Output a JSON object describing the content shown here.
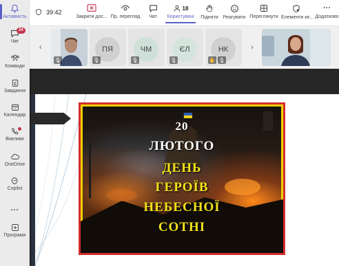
{
  "rail": {
    "items": [
      {
        "label": "Активність",
        "icon": "bell-icon"
      },
      {
        "label": "Чат",
        "icon": "chat-icon",
        "badge": "24"
      },
      {
        "label": "Команди",
        "icon": "teams-icon"
      },
      {
        "label": "Завдання",
        "icon": "tasks-icon"
      },
      {
        "label": "Календар",
        "icon": "calendar-icon"
      },
      {
        "label": "Виклики",
        "icon": "phone-icon"
      },
      {
        "label": "OneDrive",
        "icon": "cloud-icon"
      },
      {
        "label": "Copilot",
        "icon": "copilot-icon"
      },
      {
        "label": "...",
        "icon": "more-icon"
      },
      {
        "label": "Програми",
        "icon": "apps-icon"
      }
    ]
  },
  "topbar": {
    "timer": "39:42",
    "buttons": {
      "close_share": "Закрити дос...",
      "preview": "Пр. перегляд",
      "chat": "Чат",
      "people": "Користувачі",
      "people_count": "18",
      "raise": "Підняти",
      "react": "Реагувати",
      "view": "Переглянути",
      "captions": "Елементи ке...",
      "more": "Додатково"
    }
  },
  "participants": [
    {
      "type": "video",
      "name": ""
    },
    {
      "type": "initials",
      "initials": "ПЯ"
    },
    {
      "type": "initials",
      "initials": "ЧМ"
    },
    {
      "type": "initials",
      "initials": "ЄЛ"
    },
    {
      "type": "initials",
      "initials": "НК"
    }
  ],
  "poster": {
    "line1": "20",
    "line2": "ЛЮТОГО",
    "line3": "ДЕНЬ",
    "line4": "ГЕРОЇВ",
    "line5": "НЕБЕСНОЇ",
    "line6": "СОТНІ"
  },
  "colors": {
    "accent": "#5b5fc7",
    "alert": "#c4314b",
    "poster_yellow": "#f3e21a",
    "poster_border": "#d22d2d"
  }
}
